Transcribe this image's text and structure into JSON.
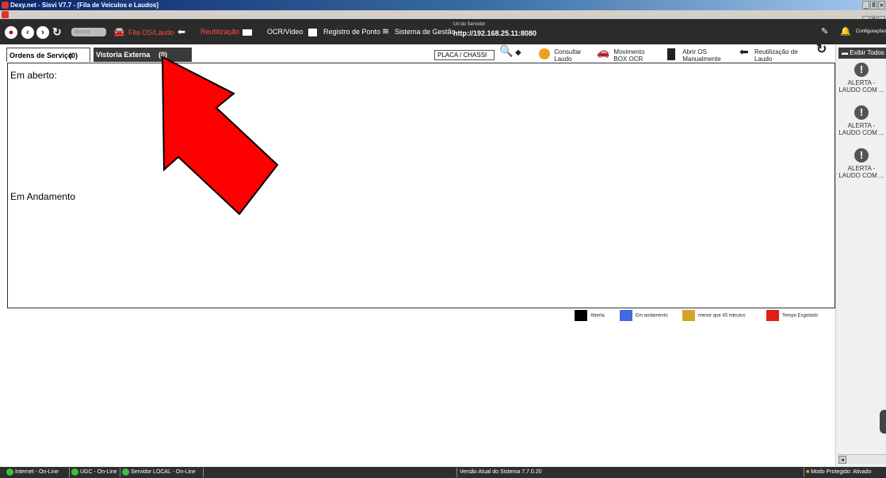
{
  "window": {
    "title": "Dexy.net - Sisvi V7.7 - [Fila de Veículos e Laudos]",
    "min": "_",
    "max": "8",
    "close": "×"
  },
  "toolbar": {
    "search_placeholder": "Busca",
    "fila": "Fila OS/Laudo",
    "reutilizacao": "Reutilização",
    "ocr": "OCR/Video",
    "registro": "Registro de Ponto",
    "sistema": "Sistema de Gestão",
    "url_label": "Url do Servidor:",
    "url_value": "http://192.168.25.11:8080",
    "configuracoes": "Configurações"
  },
  "tabs": [
    {
      "label": "Ordens de Serviço",
      "count": "(0)"
    },
    {
      "label": "Vistoria Externa",
      "count": "(0)"
    }
  ],
  "search": {
    "placeholder": "PLACA / CHASSI"
  },
  "actions": {
    "consultar": [
      "Consultar",
      "Laudo"
    ],
    "movimento": [
      "Movimento",
      "BOX OCR"
    ],
    "abrir": [
      "Abrir OS",
      "Manualmente"
    ],
    "reutilizacao_laudo": [
      "Reutilização de",
      "Laudo"
    ]
  },
  "main": {
    "em_aberto": "Em aberto:",
    "em_andamento": "Em Andamento"
  },
  "legend": [
    {
      "label": "Aberta",
      "color": "#000000"
    },
    {
      "label": "Em andamento",
      "color": "#4169e1"
    },
    {
      "label": "menor que 45 minutos",
      "color": "#d4a12a"
    },
    {
      "label": "Tempo Esgotado",
      "color": "#e41b1b"
    }
  ],
  "sidebar": {
    "exibir": "Exibir Todos",
    "alerts": [
      {
        "line1": "ALERTA -",
        "line2": "LAUDO COM ..."
      },
      {
        "line1": "ALERTA -",
        "line2": "LAUDO COM ..."
      },
      {
        "line1": "ALERTA -",
        "line2": "LAUDO COM ..."
      }
    ]
  },
  "statusbar": {
    "internet": "Internet - On-Line",
    "ugc": "UGC - On-Line",
    "servidor": "Servidor LOCAL - On-Line",
    "versao": "Versão Atual do Sistema 7.7.0.20",
    "modo": "Modo Protegido: Ativado"
  },
  "colors": {
    "annotation_arrow": "#ff0000",
    "toolbar_bg": "#2b2b2b"
  }
}
